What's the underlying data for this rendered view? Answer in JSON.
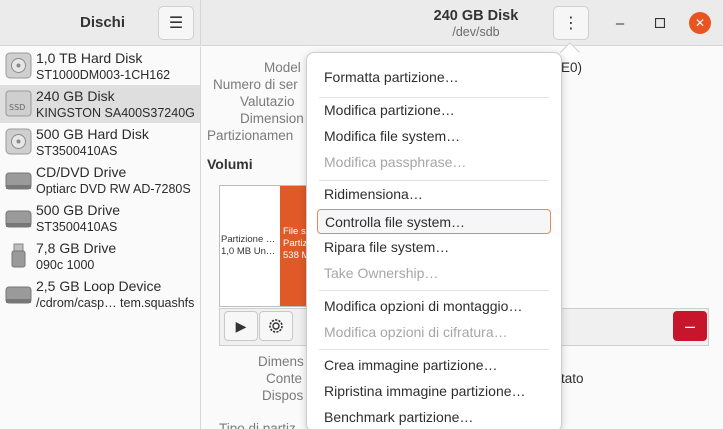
{
  "sidebar": {
    "title": "Dischi",
    "devices": [
      {
        "name": "1,0 TB Hard Disk",
        "model": "ST1000DM003-1CH162",
        "icon": "hdd-icon",
        "selected": false
      },
      {
        "name": "240 GB Disk",
        "model": "KINGSTON SA400S37240G",
        "icon": "ssd-icon",
        "selected": true
      },
      {
        "name": "500 GB Hard Disk",
        "model": "ST3500410AS",
        "icon": "hdd-icon",
        "selected": false
      },
      {
        "name": "CD/DVD Drive",
        "model": "Optiarc DVD RW AD-7280S",
        "icon": "optical-drive-icon",
        "selected": false
      },
      {
        "name": "500 GB Drive",
        "model": "ST3500410AS",
        "icon": "drive-icon",
        "selected": false
      },
      {
        "name": "7,8 GB Drive",
        "model": "090c 1000",
        "icon": "usb-icon",
        "selected": false
      },
      {
        "name": "2,5 GB Loop Device",
        "model": "/cdrom/casp… tem.squashfs",
        "icon": "drive-icon",
        "selected": false
      }
    ]
  },
  "header": {
    "title": "240 GB Disk",
    "subtitle": "/dev/sdb",
    "close_glyph": "✕"
  },
  "main": {
    "labels": [
      "Model",
      "Numero di ser",
      "Valutazio",
      "Dimension",
      "Partizionamen"
    ],
    "model_value_tail": "E0)",
    "volumes_label": "Volumi",
    "partition1": [
      "Partizione …",
      "1,0 MB Un…"
    ],
    "partition2": [
      "File s",
      "Partiz",
      "538 M"
    ],
    "lower_labels": [
      "Dimens",
      "Conte",
      "Dispos"
    ],
    "lower_value_tail": "tato",
    "cut_label": "Tipo di partiz"
  },
  "menu": {
    "items": [
      {
        "label": "Formatta partizione…",
        "disabled": false
      },
      {
        "label": "Modifica partizione…",
        "disabled": false
      },
      {
        "label": "Modifica file system…",
        "disabled": false
      },
      {
        "label": "Modifica passphrase…",
        "disabled": true
      },
      {
        "label": "Ridimensiona…",
        "disabled": false
      },
      {
        "label": "Controlla file system…",
        "disabled": false,
        "highlighted": true
      },
      {
        "label": "Ripara file system…",
        "disabled": false
      },
      {
        "label": "Take Ownership…",
        "disabled": true
      },
      {
        "label": "Modifica opzioni di montaggio…",
        "disabled": false
      },
      {
        "label": "Modifica opzioni di cifratura…",
        "disabled": true
      },
      {
        "label": "Crea immagine partizione…",
        "disabled": false
      },
      {
        "label": "Ripristina immagine partizione…",
        "disabled": false
      },
      {
        "label": "Benchmark partizione…",
        "disabled": false
      }
    ]
  },
  "colors": {
    "accent": "#e95420",
    "selection": "#dedede",
    "danger": "#c7162b",
    "partition": "#e05a28"
  }
}
